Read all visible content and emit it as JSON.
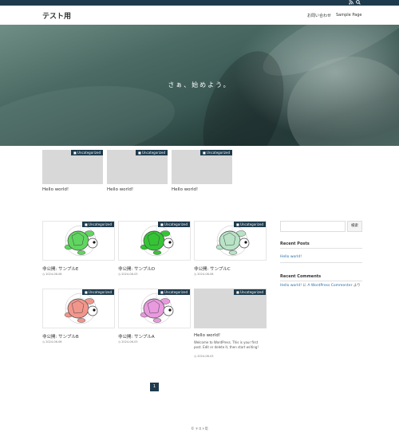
{
  "topbar": {
    "icons": [
      "rss-icon",
      "search-icon"
    ]
  },
  "header": {
    "site_title": "テスト用",
    "nav": [
      "お問い合わせ",
      "Sample Page"
    ]
  },
  "hero": {
    "tagline": "さぁ、始めよう。"
  },
  "featured": [
    {
      "category": "Uncategorized",
      "title": "Hello world!"
    },
    {
      "category": "Uncategorized",
      "title": "Hello world!"
    },
    {
      "category": "Uncategorized",
      "title": "Hello world!"
    }
  ],
  "posts": [
    {
      "category": "Uncategorized",
      "title": "非公開: サンプルE",
      "date": "2024-06-06",
      "turtle": "#5fd65f"
    },
    {
      "category": "Uncategorized",
      "title": "非公開: サンプルD",
      "date": "2024-06-03",
      "turtle": "#35c435"
    },
    {
      "category": "Uncategorized",
      "title": "非公開: サンプルC",
      "date": "2024-06-06",
      "turtle": "#b9e3c6"
    },
    {
      "category": "Uncategorized",
      "title": "非公開: サンプルB",
      "date": "2024-06-06",
      "turtle": "#f2968c"
    },
    {
      "category": "Uncategorized",
      "title": "非公開: サンプルA",
      "date": "2024-06-03",
      "turtle": "#e99adf"
    },
    {
      "category": "Uncategorized",
      "title": "Hello world!",
      "date": "2024-06-03",
      "excerpt": "Welcome to WordPress. This is your first post. Edit or delete it, then start writing!"
    }
  ],
  "sidebar": {
    "search_button": "検索",
    "recent_posts_heading": "Recent Posts",
    "recent_posts": [
      "Hello world!"
    ],
    "recent_comments_heading": "Recent Comments",
    "comment_author": "Hello world!",
    "comment_connector": " に ",
    "comment_post": "A WordPress Commenter",
    "comment_suffix": " より"
  },
  "pagination": {
    "current": "1"
  },
  "footer": {
    "copyright": "© テスト用"
  },
  "colors": {
    "accent": "#1e3b4d",
    "link": "#2a6fa8"
  }
}
